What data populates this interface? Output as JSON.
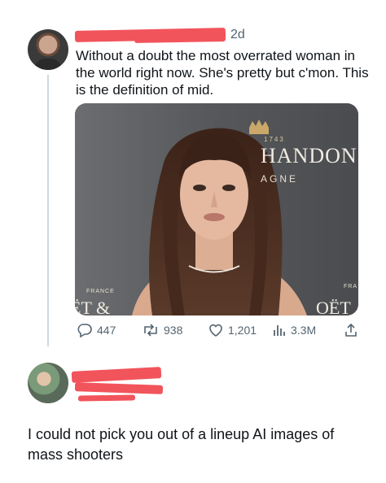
{
  "post": {
    "time": "2d",
    "text": "Without a doubt the most overrated woman in the world right now. She's pretty but c'mon. This is the definition of mid.",
    "media": {
      "backdrop_text_1": "1743",
      "backdrop_text_2": "HANDON",
      "backdrop_text_3": "AGNE",
      "backdrop_text_4": "FRANCE",
      "backdrop_text_5": "ËT &",
      "backdrop_text_6": "OËT",
      "backdrop_text_7": "FRA"
    },
    "metrics": {
      "replies": "447",
      "reposts": "938",
      "likes": "1,201",
      "views": "3.3M"
    }
  },
  "reply": {
    "text": "I could not pick you out of a lineup AI images of mass shooters"
  },
  "colors": {
    "redaction": "#f2545b",
    "muted": "#536471",
    "text": "#0f1419"
  }
}
